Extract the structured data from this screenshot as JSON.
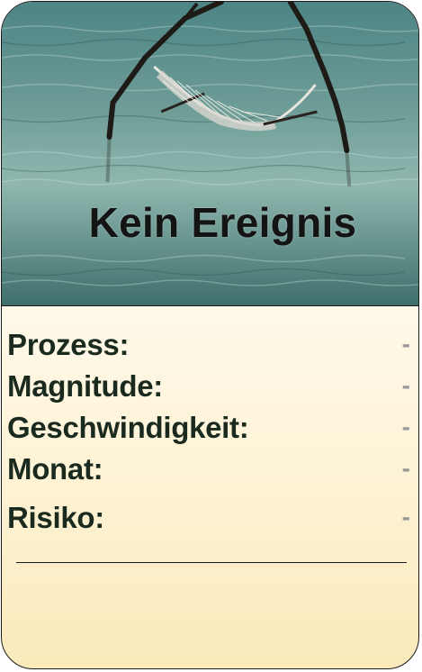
{
  "card": {
    "title": "Kein Ereignis",
    "stats": [
      {
        "label": "Prozess:",
        "value": "-"
      },
      {
        "label": "Magnitude:",
        "value": "-"
      },
      {
        "label": "Geschwindigkeit:",
        "value": "-"
      },
      {
        "label": "Monat:",
        "value": "-"
      }
    ],
    "risk": {
      "label": "Risiko:",
      "value": "-"
    }
  }
}
